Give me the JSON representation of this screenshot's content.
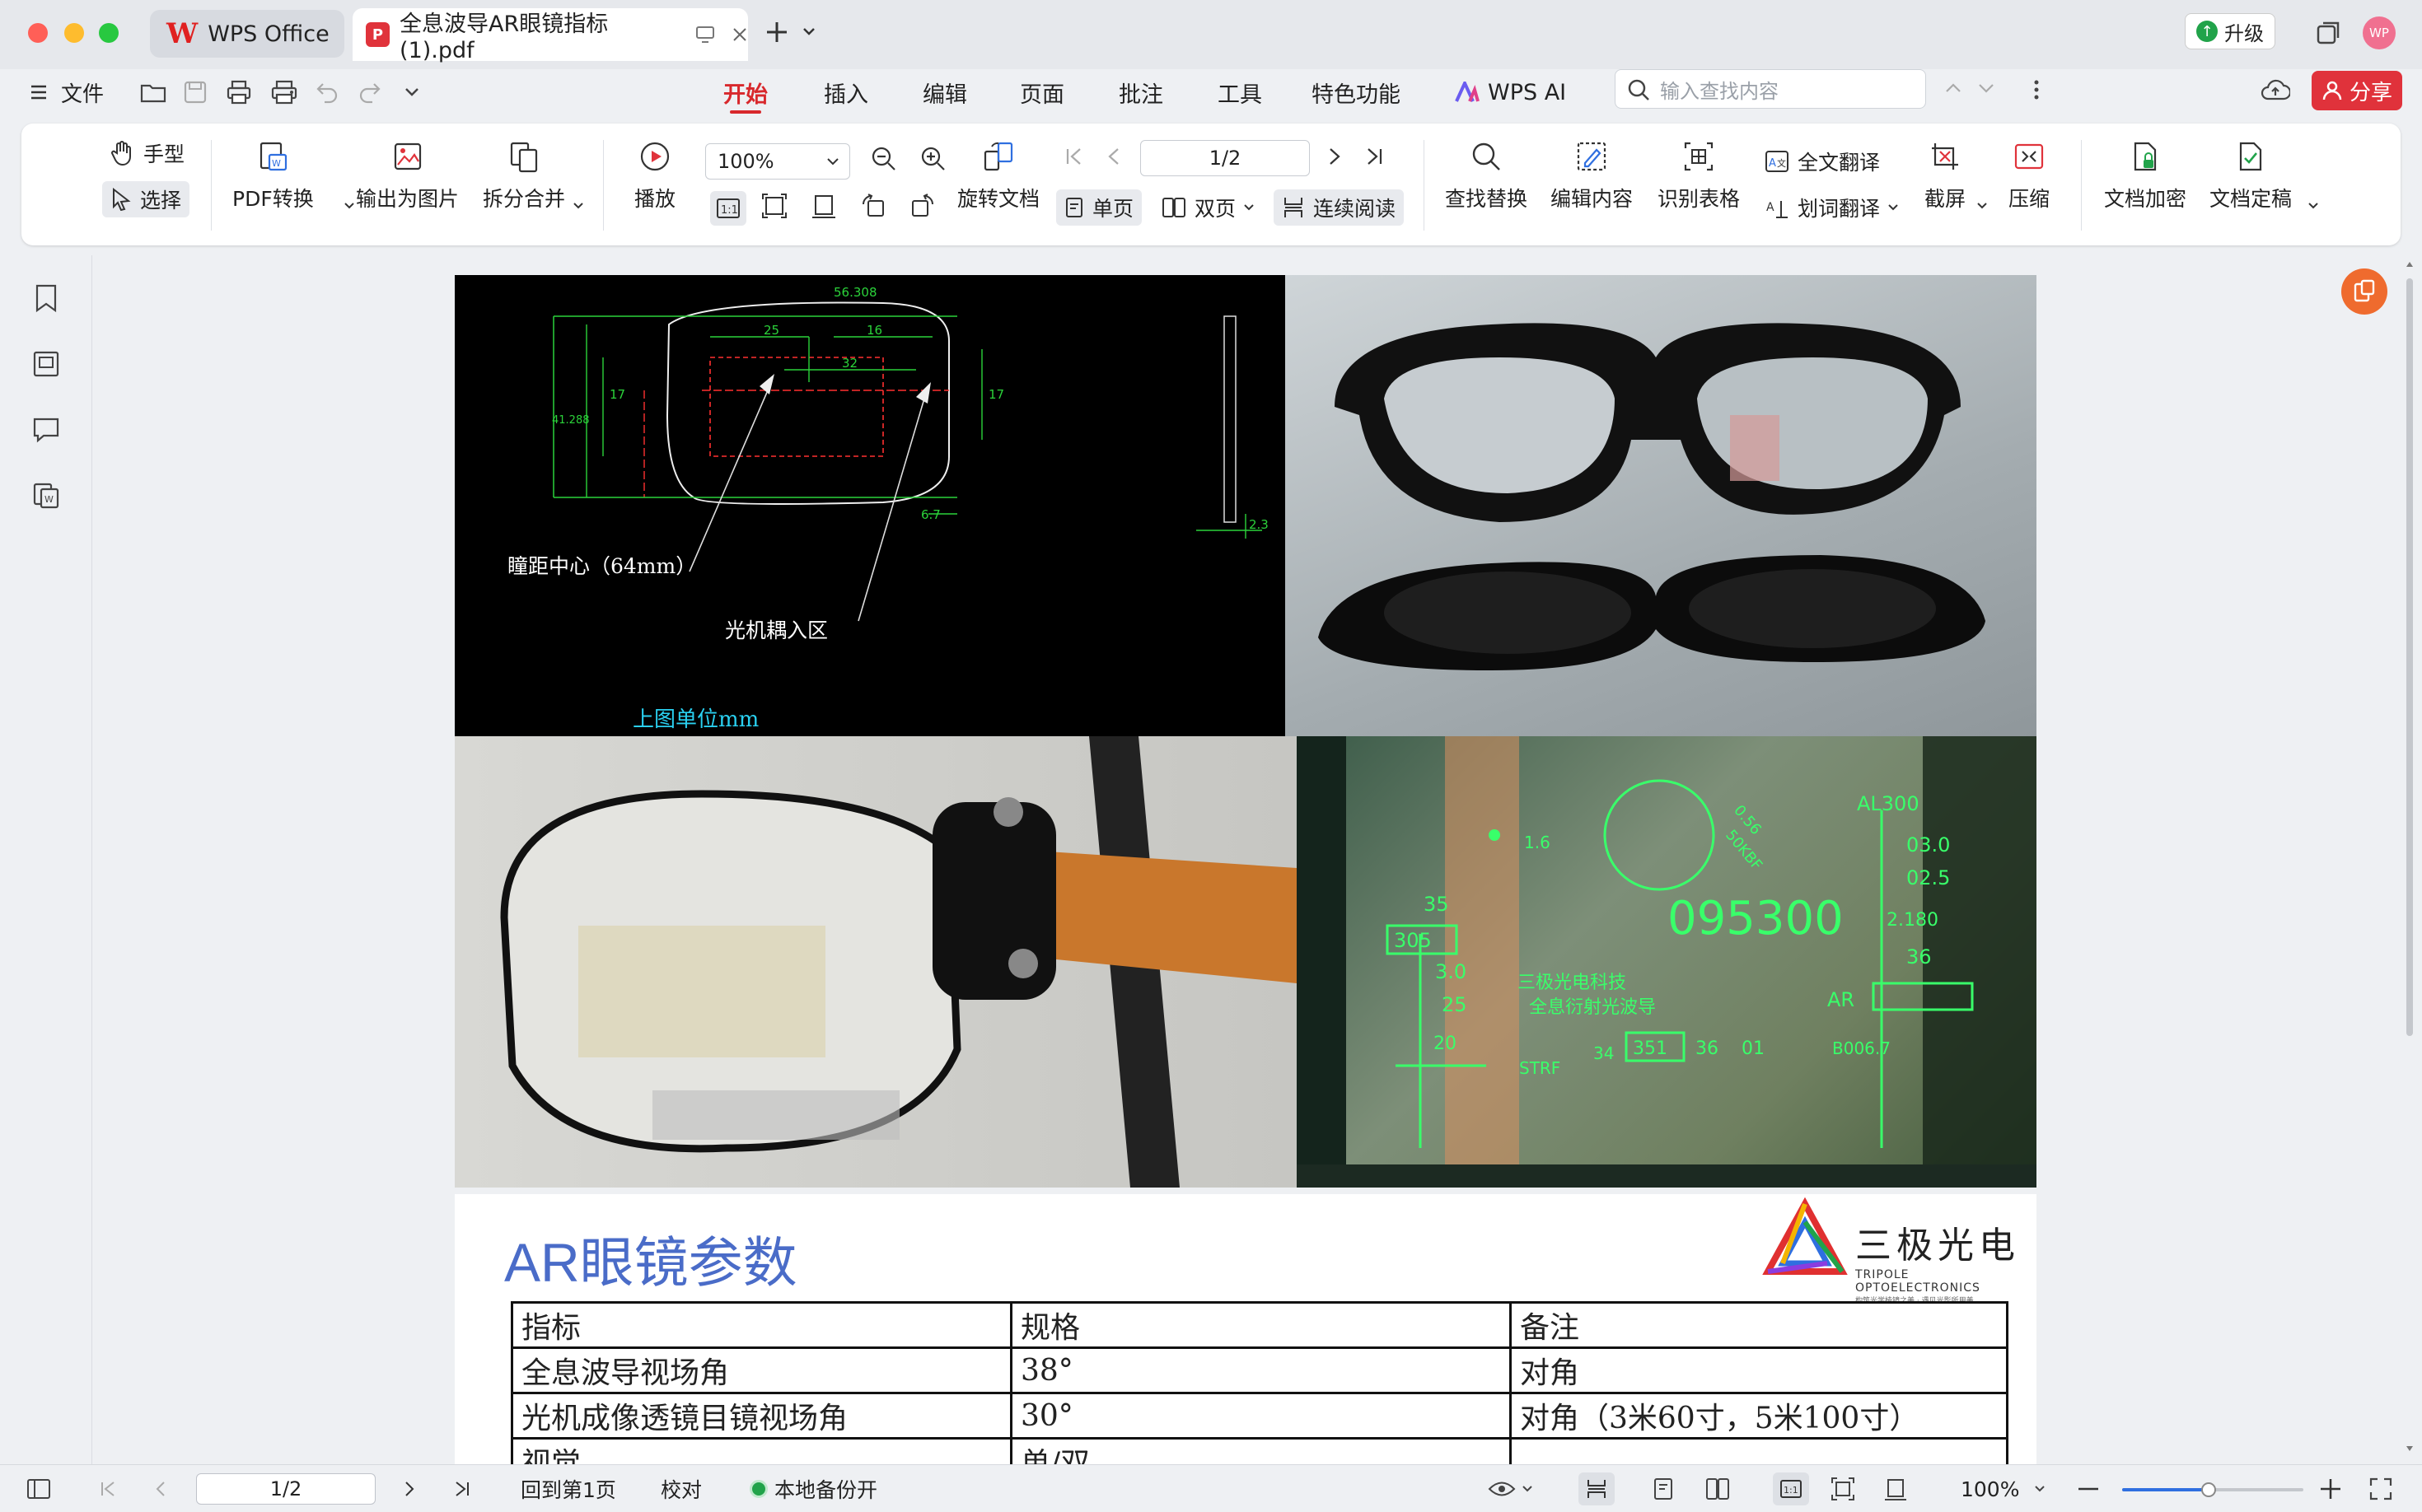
{
  "titlebar": {
    "home_tab": "WPS Office",
    "doc_tab": "全息波导AR眼镜指标(1).pdf",
    "upgrade": "升级",
    "avatar": "WP"
  },
  "menu": {
    "file": "文件",
    "tabs": [
      "开始",
      "插入",
      "编辑",
      "页面",
      "批注",
      "工具",
      "特色功能",
      "WPS AI"
    ],
    "search_placeholder": "输入查找内容",
    "share": "分享"
  },
  "ribbon": {
    "hand": "手型",
    "select": "选择",
    "pdf_convert": "PDF转换",
    "export_image": "输出为图片",
    "split_merge": "拆分合并",
    "play": "播放",
    "zoom": "100%",
    "rotate": "旋转文档",
    "page": "1/2",
    "single": "单页",
    "double": "双页",
    "continuous": "连续阅读",
    "find_replace": "查找替换",
    "edit_content": "编辑内容",
    "recognize_table": "识别表格",
    "full_translate": "全文翻译",
    "word_translate": "划词翻译",
    "screenshot": "截屏",
    "compress": "压缩",
    "encrypt": "文档加密",
    "finalize": "文档定稿"
  },
  "page1": {
    "label_pupil": "瞳距中心（64mm）",
    "label_coupling": "光机耦入区",
    "label_unit": "上图单位mm",
    "dims": [
      "56.308",
      "25",
      "16",
      "32",
      "17",
      "41.288",
      "17",
      "6.7",
      "2.3"
    ],
    "hud": [
      "AL300",
      "03.0",
      "02.5",
      "2.180",
      "36",
      "095300",
      "305",
      "35",
      "3.0",
      "25",
      "20",
      "351",
      "36",
      "01",
      "AR",
      "B006.7",
      "STRF",
      "34",
      "1.6",
      "0.56",
      "50KBF",
      "三极光电科技",
      "全息衍射光波导"
    ]
  },
  "page2": {
    "title": "AR眼镜参数",
    "brand_cn": "三极光电",
    "brand_en": "TRIPOLE OPTOELECTRONICS",
    "brand_tagline": "构筑光学棱镜之美 · 遇见光影所用美",
    "headers": [
      "指标",
      "规格",
      "备注"
    ],
    "rows": [
      [
        "全息波导视场角",
        "38°",
        "对角"
      ],
      [
        "光机成像透镜目镜视场角",
        "30°",
        "对角（3米60寸，5米100寸）"
      ],
      [
        "视觉",
        "单/双",
        ""
      ]
    ]
  },
  "status": {
    "page": "1/2",
    "back_first": "回到第1页",
    "proofread": "校对",
    "backup": "本地备份开",
    "zoom": "100%"
  },
  "colors": {
    "accent": "#d8282c",
    "share": "#e0323b",
    "title_blue": "#4a6cc8",
    "hud_green": "#39ff6a"
  }
}
